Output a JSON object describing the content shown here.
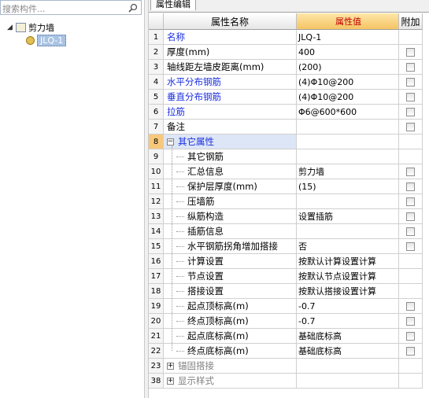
{
  "search": {
    "placeholder": "搜索构件..."
  },
  "tree": {
    "root": {
      "label": "剪力墙"
    },
    "child": {
      "label": "JLQ-1"
    }
  },
  "tab": {
    "label": "属性编辑"
  },
  "columns": {
    "name": "属性名称",
    "value": "属性值",
    "add": "附加"
  },
  "rows": [
    {
      "num": "1",
      "name": "名称",
      "value": "JLQ-1",
      "style": "blue",
      "level": 0,
      "checkbox": false
    },
    {
      "num": "2",
      "name": "厚度(mm)",
      "value": "400",
      "style": "black",
      "level": 0,
      "checkbox": true
    },
    {
      "num": "3",
      "name": "轴线距左墙皮距离(mm)",
      "value": "(200)",
      "style": "black",
      "level": 0,
      "checkbox": true
    },
    {
      "num": "4",
      "name": "水平分布钢筋",
      "value": "(4)Φ10@200",
      "style": "blue",
      "level": 0,
      "checkbox": true
    },
    {
      "num": "5",
      "name": "垂直分布钢筋",
      "value": "(4)Φ10@200",
      "style": "blue",
      "level": 0,
      "checkbox": true
    },
    {
      "num": "6",
      "name": "拉筋",
      "value": "Φ6@600*600",
      "style": "blue",
      "level": 0,
      "checkbox": true
    },
    {
      "num": "7",
      "name": "备注",
      "value": "",
      "style": "black",
      "level": 0,
      "checkbox": true
    },
    {
      "num": "8",
      "name": "其它属性",
      "value": "",
      "style": "group",
      "level": 0,
      "checkbox": false,
      "expander": "−"
    },
    {
      "num": "9",
      "name": "其它钢筋",
      "value": "",
      "style": "black",
      "level": 1,
      "checkbox": false
    },
    {
      "num": "10",
      "name": "汇总信息",
      "value": "剪力墙",
      "style": "black",
      "level": 1,
      "checkbox": true
    },
    {
      "num": "11",
      "name": "保护层厚度(mm)",
      "value": "(15)",
      "style": "black",
      "level": 1,
      "checkbox": true
    },
    {
      "num": "12",
      "name": "压墙筋",
      "value": "",
      "style": "black",
      "level": 1,
      "checkbox": true
    },
    {
      "num": "13",
      "name": "纵筋构造",
      "value": "设置插筋",
      "style": "black",
      "level": 1,
      "checkbox": true
    },
    {
      "num": "14",
      "name": "插筋信息",
      "value": "",
      "style": "black",
      "level": 1,
      "checkbox": true
    },
    {
      "num": "15",
      "name": "水平钢筋拐角增加搭接",
      "value": "否",
      "style": "black",
      "level": 1,
      "checkbox": true
    },
    {
      "num": "16",
      "name": "计算设置",
      "value": "按默认计算设置计算",
      "style": "black",
      "level": 1,
      "checkbox": false
    },
    {
      "num": "17",
      "name": "节点设置",
      "value": "按默认节点设置计算",
      "style": "black",
      "level": 1,
      "checkbox": false
    },
    {
      "num": "18",
      "name": "搭接设置",
      "value": "按默认搭接设置计算",
      "style": "black",
      "level": 1,
      "checkbox": false
    },
    {
      "num": "19",
      "name": "起点顶标高(m)",
      "value": "-0.7",
      "style": "black",
      "level": 1,
      "checkbox": true
    },
    {
      "num": "20",
      "name": "终点顶标高(m)",
      "value": "-0.7",
      "style": "black",
      "level": 1,
      "checkbox": true
    },
    {
      "num": "21",
      "name": "起点底标高(m)",
      "value": "基础底标高",
      "style": "black",
      "level": 1,
      "checkbox": true
    },
    {
      "num": "22",
      "name": "终点底标高(m)",
      "value": "基础底标高",
      "style": "black",
      "level": 1,
      "checkbox": true
    },
    {
      "num": "23",
      "name": "锚固搭接",
      "value": "",
      "style": "collapsed",
      "level": 0,
      "checkbox": false,
      "expander": "+"
    },
    {
      "num": "38",
      "name": "显示样式",
      "value": "",
      "style": "collapsed",
      "level": 0,
      "checkbox": false,
      "expander": "+"
    }
  ],
  "colors": {
    "value_header": "#f5c463",
    "link_blue": "#1a2ee0",
    "active_row": "#f8c87a"
  }
}
